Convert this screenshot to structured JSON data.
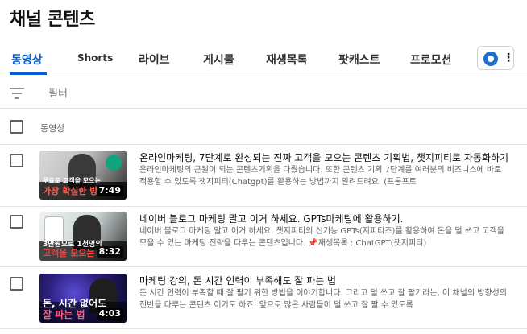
{
  "page_title": "채널 콘텐츠",
  "tabs": [
    {
      "label": "동영상",
      "active": true
    },
    {
      "label": "Shorts",
      "active": false
    },
    {
      "label": "라이브",
      "active": false
    },
    {
      "label": "게시물",
      "active": false
    },
    {
      "label": "재생목록",
      "active": false
    },
    {
      "label": "팟캐스트",
      "active": false
    },
    {
      "label": "프로모션",
      "active": false
    }
  ],
  "channel_button": {
    "icon": "channel-logo-icon",
    "menu_icon": "more-vert-icon",
    "kebab": "⋮"
  },
  "filter": {
    "icon": "filter-icon",
    "placeholder": "필터",
    "value": ""
  },
  "table": {
    "header_label": "동영상"
  },
  "videos": [
    {
      "title": "온라인마케팅, 7단계로 완성되는 진짜 고객을 모으는 콘텐츠 기획법, 챗지피티로 자동화하기",
      "description": "온라인마케팅의 근원이 되는 콘텐츠기획을 다뤘습니다. 또한 콘텐츠 기획 7단계를 여러분의 비즈니스에 바로 적용할 수 있도록 챗지피티(Chatgpt)를 활용하는 방법까지 알려드려요. (프롬프트",
      "duration": "7:49",
      "thumb_caption_top": "무료로 고객을 모으는",
      "thumb_caption_main": "가장 확실한 방",
      "thumb_caption_color": "#ff5a4a"
    },
    {
      "title": "네이버 블로그 마케팅 말고 이거 하세요. GPTs마케팅에 활용하기.",
      "description": "네이버 블로그 마케팅 말고 이거 하세요. 챗지피티의 신기능 GPTs(지피티즈)를 활용하여 돈을 덜 쓰고 고객을 모을 수 있는 마케팅 전략을 다루는 콘텐츠입니다. 📌재생목록 : ChatGPT(챗지피티)",
      "duration": "8:32",
      "thumb_caption_top": "3만원으로 1천명의",
      "thumb_caption_main": "고객을 모으는",
      "thumb_caption_color": "#ff3b3b"
    },
    {
      "title": "마케팅 강의, 돈 시간 인력이 부족해도 잘 파는 법",
      "description": "돈 시간 인력이 부족할 때 잘 팔기 위한 방법을 이야기합니다. 그리고 덜 쓰고 잘 팔기라는, 이 채널의 방향성의 전반을 다루는 콘텐츠 이기도 하죠! 앞으로 많은 사람들이 덜 쓰고 잘 팔 수 있도록",
      "duration": "4:03",
      "thumb_caption_top": "돈, 시간 없어도",
      "thumb_caption_main": "잘 파는 법",
      "thumb_caption_color": "#ff5a7a"
    }
  ],
  "colors": {
    "accent": "#065fd4",
    "text": "#0f0f0f",
    "secondary_text": "#606060",
    "divider": "#e5e5e5"
  }
}
